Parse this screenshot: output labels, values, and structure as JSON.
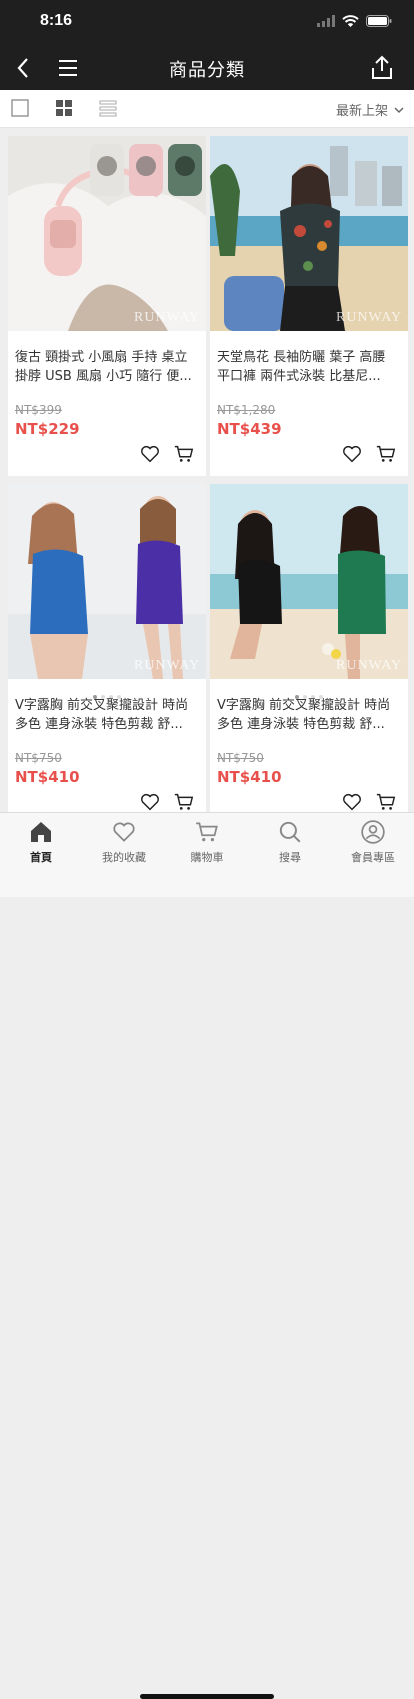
{
  "status_bar": {
    "time": "8:16"
  },
  "nav": {
    "title": "商品分類"
  },
  "toolbar": {
    "sort_label": "最新上架"
  },
  "products": [
    {
      "name": "復古 頸掛式 小風扇 手持 桌立 掛脖 USB 風扇 小巧 隨行 便...",
      "original_price": "NT$399",
      "price": "NT$229",
      "watermark": "RUNWAY"
    },
    {
      "name": "天堂鳥花 長袖防曬 葉子 高腰 平口褲 兩件式泳裝 比基尼...",
      "original_price": "NT$1,280",
      "price": "NT$439",
      "watermark": "RUNWAY"
    },
    {
      "name": "V字露胸 前交叉聚攏設計 時尚 多色 連身泳裝 特色剪裁 舒...",
      "original_price": "NT$750",
      "price": "NT$410",
      "watermark": "RUNWAY"
    },
    {
      "name": "V字露胸 前交叉聚攏設計 時尚 多色 連身泳裝 特色剪裁 舒...",
      "original_price": "NT$750",
      "price": "NT$410",
      "watermark": "RUNWAY"
    }
  ],
  "tabbar": {
    "items": [
      {
        "label": "首頁",
        "icon": "home-icon"
      },
      {
        "label": "我的收藏",
        "icon": "heart-icon"
      },
      {
        "label": "購物車",
        "icon": "cart-icon"
      },
      {
        "label": "搜尋",
        "icon": "search-icon"
      },
      {
        "label": "會員專區",
        "icon": "user-icon"
      }
    ]
  },
  "colors": {
    "bar": "#1f1f1f",
    "price": "#e8504c",
    "background": "#eeeeee"
  }
}
